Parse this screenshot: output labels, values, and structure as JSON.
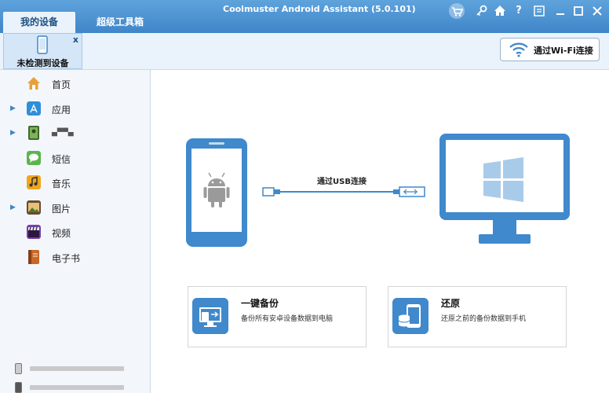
{
  "app": {
    "title": "Coolmuster Android Assistant (5.0.101)"
  },
  "tabs": [
    {
      "label": "我的设备"
    },
    {
      "label": "超级工具箱"
    }
  ],
  "device_tab": {
    "label": "未检测到设备",
    "close": "x"
  },
  "wifi_button": {
    "label": "通过Wi-Fi连接"
  },
  "sidebar": {
    "items": [
      {
        "label": "首页"
      },
      {
        "label": "应用"
      },
      {
        "label": "▄▀▀▄"
      },
      {
        "label": "短信"
      },
      {
        "label": "音乐"
      },
      {
        "label": "图片"
      },
      {
        "label": "视频"
      },
      {
        "label": "电子书"
      }
    ]
  },
  "main": {
    "usb_label": "通过USB连接",
    "cards": [
      {
        "title": "一键备份",
        "desc": "备份所有安卓设备数据到电脑"
      },
      {
        "title": "还原",
        "desc": "还原之前的备份数据到手机"
      }
    ]
  },
  "colors": {
    "accent": "#3f89cc",
    "titlebar": "#4a92d2",
    "sidebar": "#f3f7fc"
  }
}
